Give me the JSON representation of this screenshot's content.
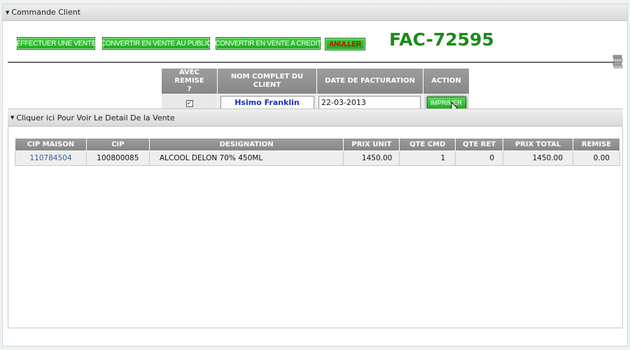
{
  "section": {
    "title": "Commande Client"
  },
  "actions": {
    "effectuer": "EFFECTUER UNE VENTE",
    "convertir_public": "CONVERTIR EN VENTE AU PUBLIC",
    "convertir_credit": "CONVERTIR EN VENTE A CREDIT",
    "annuler": "ANULLER"
  },
  "invoice": {
    "number": "FAC-72595"
  },
  "client_table": {
    "headers": {
      "remise_line1": "AVEC REMISE",
      "remise_line2": "?",
      "nom": "NOM COMPLET DU CLIENT",
      "date": "DATE DE FACTURATION",
      "action": "ACTION"
    },
    "row": {
      "remise_checked": "☑",
      "client_name": "Hsimo Franklin",
      "date": "22-03-2013",
      "print_label": "IMPRIMER"
    }
  },
  "detail": {
    "toggle_label": "Cliquer ici Pour Voir Le Detail De la Vente",
    "headers": [
      "CIP MAISON",
      "CIP",
      "DESIGNATION",
      "PRIX UNIT",
      "QTE CMD",
      "QTE RET",
      "PRIX TOTAL",
      "REMISE"
    ],
    "rows": [
      {
        "cip_maison": "110784504",
        "cip": "100800085",
        "designation": "ALCOOL DELON 70% 450ML",
        "prix_unit": "1450.00",
        "qte_cmd": "1",
        "qte_ret": "0",
        "prix_total": "1450.00",
        "remise": "0.00"
      }
    ]
  },
  "colors": {
    "accent_green": "#1a8a1a",
    "button_green": "#22aa22",
    "header_gray": "#8f8f8f",
    "client_blue": "#1a2fb8",
    "link_blue": "#3a5a99",
    "cancel_red": "#cc0000"
  }
}
